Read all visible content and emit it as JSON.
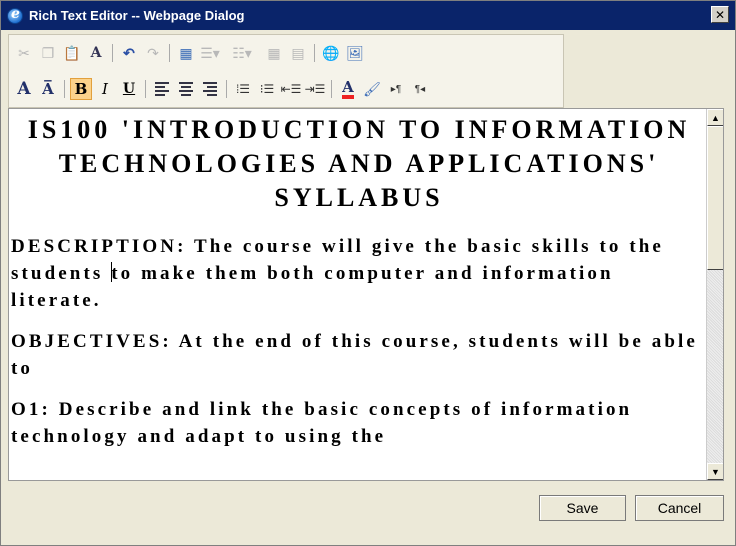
{
  "window": {
    "title": "Rich Text Editor -- Webpage Dialog"
  },
  "toolbar": {
    "row1": [
      "cut-icon",
      "copy-icon",
      "paste-icon",
      "spellcheck-icon",
      "undo-icon",
      "redo-icon",
      "insert-table-icon",
      "table-row-icon",
      "table-column-icon",
      "table-grid-icon",
      "table-props-icon",
      "insert-link-icon",
      "insert-image-icon"
    ],
    "row2": [
      "font-icon",
      "font-size-icon",
      "bold-icon",
      "italic-icon",
      "underline-icon",
      "align-left-icon",
      "align-center-icon",
      "align-right-icon",
      "ordered-list-icon",
      "unordered-list-icon",
      "outdent-icon",
      "indent-icon",
      "font-color-icon",
      "highlight-color-icon",
      "ltr-icon",
      "rtl-icon"
    ],
    "glyphs": {
      "bold": "B",
      "italic": "I",
      "underline": "U",
      "font": "A",
      "font_size": "A̅",
      "ltr": "▸¶",
      "rtl": "¶◂"
    }
  },
  "editor": {
    "title": "IS100 'INTRODUCTION TO INFORMATION TECHNOLOGIES AND APPLICATIONS' SYLLABUS",
    "description_before_caret": "DESCRIPTION: The course will give the basic skills to the students ",
    "description_after_caret": "to make them both computer and information literate.",
    "objectives": "OBJECTIVES: At the end of this course, students will be able to",
    "o1": "O1: Describe and link the basic concepts of information technology and adapt to using the"
  },
  "buttons": {
    "save": "Save",
    "cancel": "Cancel"
  },
  "colors": {
    "titlebar": "#0a246a",
    "dialog_bg": "#ece9d8",
    "active_toggle": "#fbd28b"
  }
}
